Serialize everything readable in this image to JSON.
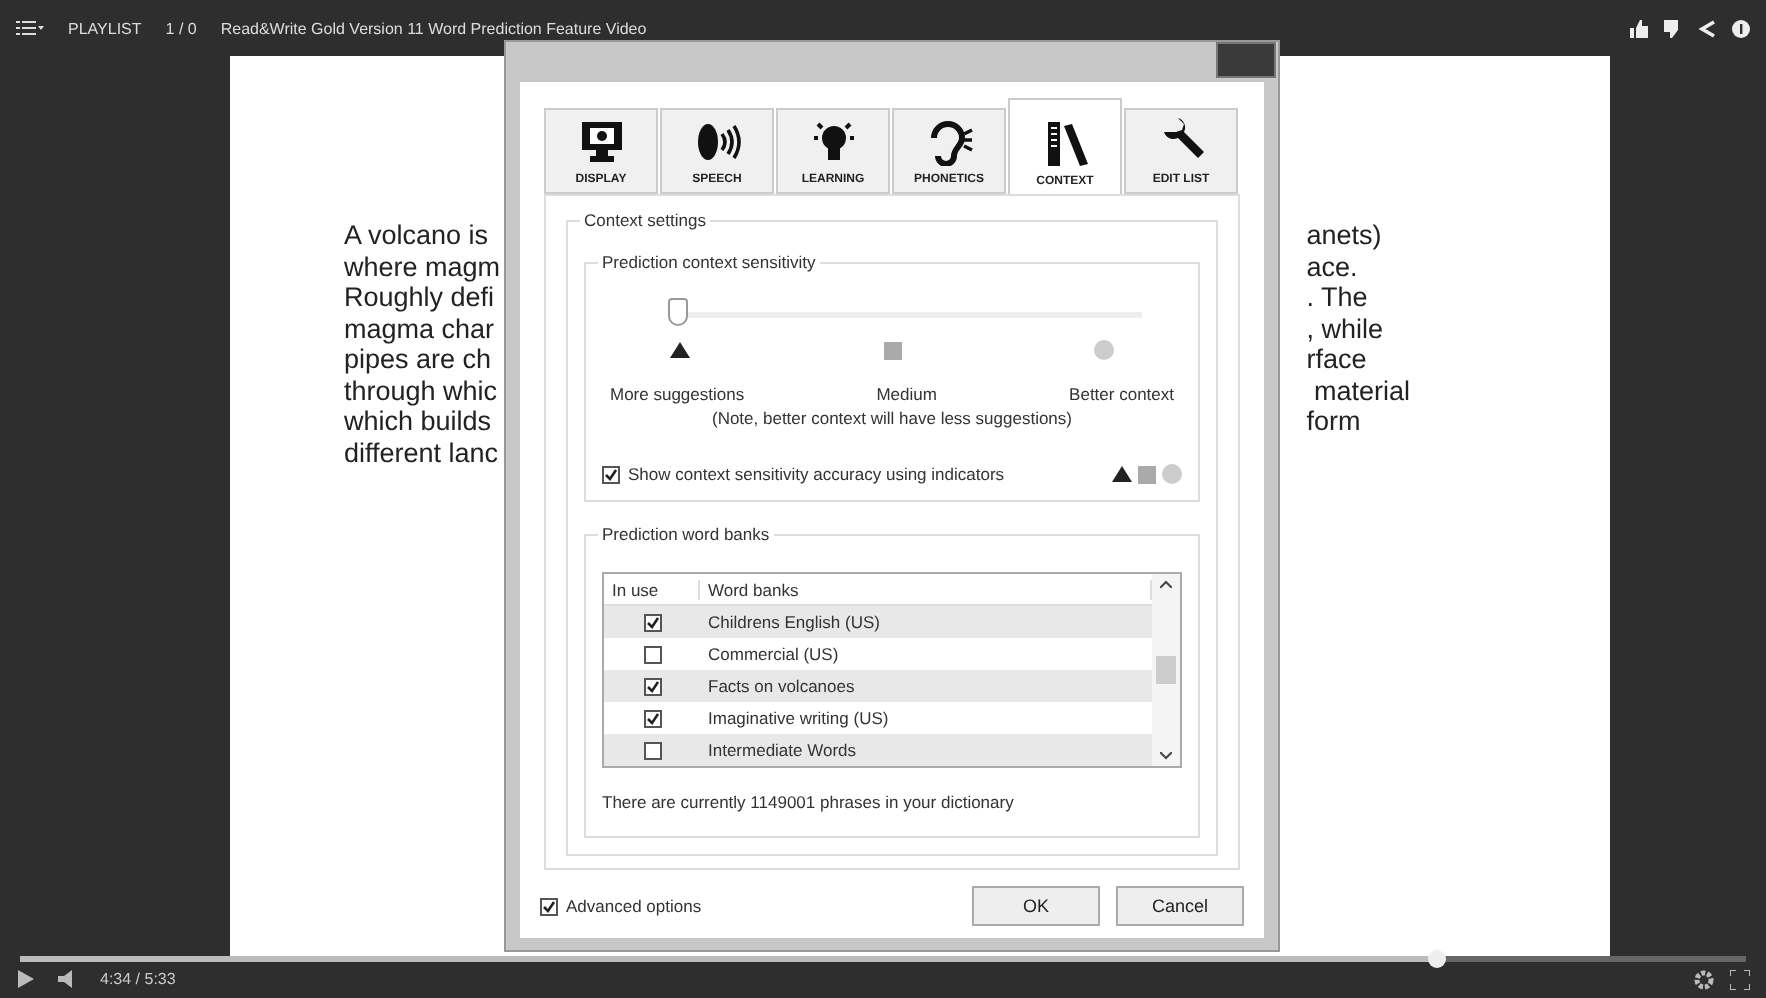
{
  "top_bar": {
    "playlist_label": "PLAYLIST",
    "playlist_count": "1 / 0",
    "video_title": "Read&Write Gold Version 11 Word Prediction Feature Video"
  },
  "video_text": {
    "left_lines": [
      "A volcano is",
      "where magm",
      "Roughly defi",
      "magma char",
      "pipes are ch",
      "through whic",
      "which builds",
      "different lanc"
    ],
    "right_lines": [
      "anets)",
      "ace.",
      ". The",
      ", while",
      "rface",
      " material",
      "form"
    ]
  },
  "dialog": {
    "tabs": [
      {
        "label": "DISPLAY",
        "kind": "display",
        "selected": false
      },
      {
        "label": "SPEECH",
        "kind": "speech",
        "selected": false
      },
      {
        "label": "LEARNING",
        "kind": "learning",
        "selected": false
      },
      {
        "label": "PHONETICS",
        "kind": "phonetics",
        "selected": false
      },
      {
        "label": "CONTEXT",
        "kind": "context",
        "selected": true
      },
      {
        "label": "EDIT LIST",
        "kind": "editlist",
        "selected": false
      }
    ],
    "context_group": "Context settings",
    "sensitivity": {
      "title": "Prediction context sensitivity",
      "level": 0,
      "labels": [
        "More suggestions",
        "Medium",
        "Better context"
      ],
      "note": "(Note, better context will have less suggestions)",
      "indicator_label": "Show context sensitivity accuracy using indicators",
      "indicators_checked": true
    },
    "word_banks": {
      "title": "Prediction word banks",
      "columns": [
        "In use",
        "Word banks"
      ],
      "rows": [
        {
          "name": "Childrens English (US)",
          "checked": true,
          "shaded": true
        },
        {
          "name": "Commercial (US)",
          "checked": false,
          "shaded": false
        },
        {
          "name": "Facts on volcanoes",
          "checked": true,
          "shaded": true
        },
        {
          "name": "Imaginative writing (US)",
          "checked": true,
          "shaded": false
        },
        {
          "name": "Intermediate Words",
          "checked": false,
          "shaded": true
        }
      ],
      "summary": "There are currently 1149001 phrases in your dictionary"
    },
    "advanced_options": {
      "label": "Advanced options",
      "checked": true
    },
    "buttons": [
      "OK",
      "Cancel"
    ]
  },
  "player": {
    "time": "4:34 / 5:33",
    "progress": {
      "level": 0.82
    }
  }
}
